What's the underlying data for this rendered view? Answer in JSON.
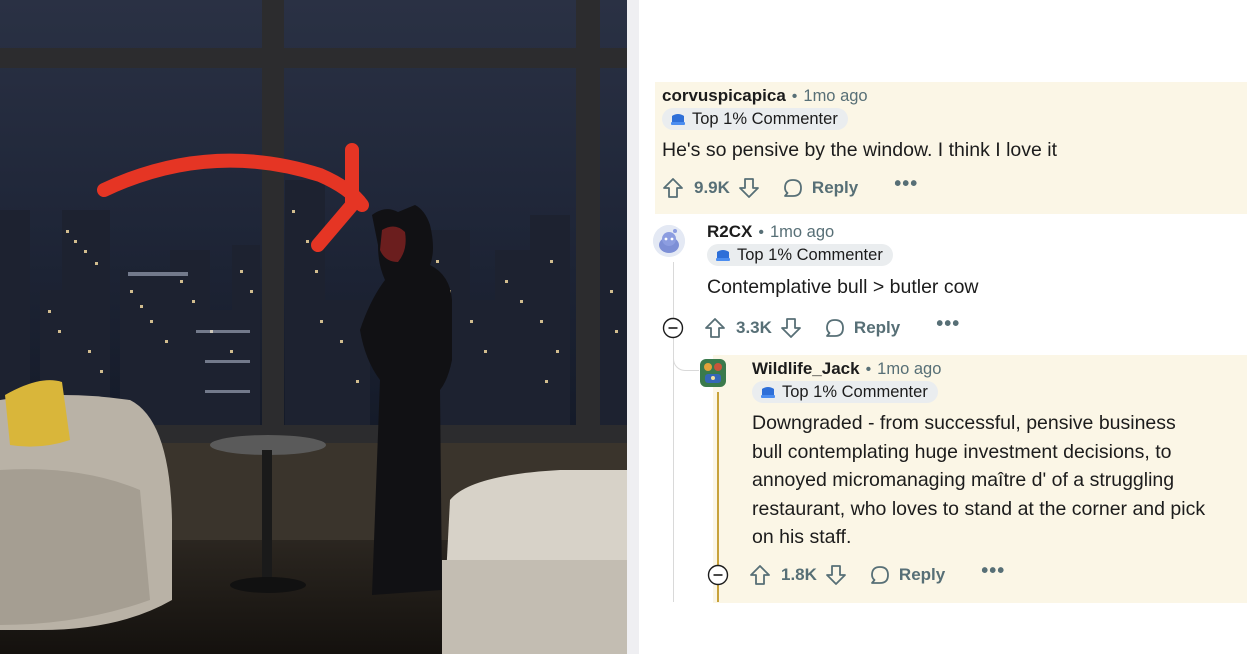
{
  "comments": [
    {
      "author": "corvuspicapica",
      "time": "1mo ago",
      "badge": "Top 1% Commenter",
      "body": "He's so pensive by the window. I think I love it",
      "votes": "9.9K",
      "reply_label": "Reply",
      "more_label": "•••"
    },
    {
      "author": "R2CX",
      "time": "1mo ago",
      "badge": "Top 1% Commenter",
      "body": "Contemplative bull > butler cow",
      "votes": "3.3K",
      "reply_label": "Reply",
      "more_label": "•••"
    },
    {
      "author": "Wildlife_Jack",
      "time": "1mo ago",
      "badge": "Top 1% Commenter",
      "body_lines": [
        "Downgraded - from successful, pensive business",
        "bull contemplating huge investment decisions, to",
        "annoyed micromanaging maître d' of a struggling",
        "restaurant, who loves to stand at the corner and pick",
        "on his staff."
      ],
      "votes": "1.8K",
      "reply_label": "Reply",
      "more_label": "•••"
    }
  ],
  "icons": {
    "upvote": "upvote-icon",
    "downvote": "downvote-icon",
    "reply": "reply-bubble-icon",
    "collapse": "collapse-minus-icon",
    "badge": "top-commenter-badge-icon"
  },
  "colors": {
    "highlight": "#fbf6e6",
    "muted_text": "#576f76",
    "badge_bg": "#eaedef",
    "arrow": "#e53524",
    "thread_accent": "#c8a23a"
  }
}
